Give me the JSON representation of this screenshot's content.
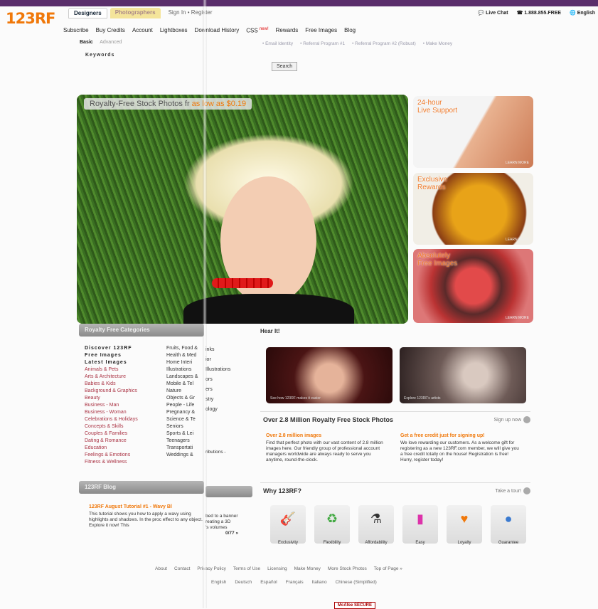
{
  "logo": "123RF",
  "top_tabs": [
    "Designers",
    "Photographers",
    "Sign In • Register"
  ],
  "top_right": [
    "Live Chat",
    "1.888.855.FREE",
    "English"
  ],
  "nav": [
    "Subscribe",
    "Buy Credits",
    "Account",
    "Lightboxes",
    "Download History",
    "CSS",
    "Rewards",
    "Free Images",
    "Blog"
  ],
  "nav_new": "new!",
  "search": {
    "basic": "Basic",
    "advanced": "Advanced",
    "keywords": "Keywords",
    "button": "Search"
  },
  "sub_links": [
    "• Email Identity",
    "• Referral Program #1",
    "• Referral Program #2 (Robust)",
    "• Make Money"
  ],
  "hero": {
    "banner": "Royalty-Free Stock Photos fr",
    "banner_price": "as low as $0.19"
  },
  "side": [
    {
      "caption_1": "24-hour",
      "caption_2": "Live Support",
      "tag": "LEARN MORE"
    },
    {
      "caption_1": "Exclusive",
      "caption_2": "Rewards",
      "tag": "LEARN MORE"
    },
    {
      "caption_1": "Absolutely",
      "caption_2": "Free Images",
      "tag": "LEARN MORE"
    }
  ],
  "categories": {
    "heading": "Royalty Free Categories",
    "col1": [
      "Discover 123RF",
      "Free Images",
      "Latest Images",
      "Animals & Pets",
      "Arts & Architecture",
      "Babies & Kids",
      "Background & Graphics",
      "Beauty",
      "Business - Man",
      "Business - Woman",
      "Celebrations & Holidays",
      "Concepts & Skills",
      "Couples & Families",
      "Dating & Romance",
      "Education",
      "Feelings & Emotions",
      "Fitness & Wellness"
    ],
    "col2": [
      "Fruits, Food &",
      "Health & Med",
      "Home Interi",
      "Illustrations",
      "Landscapes &",
      "Mobile & Tel",
      "Nature",
      "Objects & Gr",
      "People - Life",
      "Pregnancy &",
      "Science & Te",
      "Seniors",
      "Sports & Lei",
      "Teenagers",
      "Transportati",
      "Weddings &"
    ],
    "col3": [
      "inks",
      "",
      "ior",
      "",
      "Illustrations",
      "ors",
      "",
      "ers",
      "",
      "stry",
      "ology"
    ]
  },
  "blog": {
    "heading": "123RF Blog",
    "title": "123RF August Tutorial #1 - Wavy Bl",
    "text": "This tutorial shows you how to apply a wavy using highlights and shadows. In the proc effect to any object. Explore it now! This",
    "side_text": "ributions -",
    "mid_text_1": "bed to a banner",
    "mid_text_2": "reating a 3D",
    "mid_text_3": "'s volumes",
    "more": "0/77 »"
  },
  "hear": {
    "heading": "Hear It!",
    "video_1": "See how 123RF makes it easier",
    "video_2": "Explore 123RF's artists"
  },
  "section_a": {
    "heading": "Over 2.8 Million Royalty Free Stock Photos",
    "link": "Sign up now",
    "left_title": "Over 2.8 million images",
    "left_text": "Find that perfect photo with our vast content of 2.8 million images here. Our friendly group of professional account managers worldwide are always ready to serve you anytime, round-the-clock.",
    "right_title": "Get a free credit just for signing up!",
    "right_text": "We love rewarding our customers. As a welcome gift for registering as a new 123RF.com member, we will give you a free credit totally on the house! Registration is free! Hurry, register today!"
  },
  "section_b": {
    "heading": "Why 123RF?",
    "link": "Take a tour!",
    "icons": [
      {
        "label": "Exclusivity",
        "icon": "guitar-icon",
        "glyph": "🎸"
      },
      {
        "label": "Flexibility",
        "icon": "recycle-icon",
        "glyph": "♻"
      },
      {
        "label": "Affordability",
        "icon": "flask-icon",
        "glyph": "⚗"
      },
      {
        "label": "Easy",
        "icon": "bar-chart-icon",
        "glyph": "▮"
      },
      {
        "label": "Loyalty",
        "icon": "heart-icon",
        "glyph": "♥"
      },
      {
        "label": "Guarantee",
        "icon": "shield-icon",
        "glyph": "●"
      }
    ]
  },
  "footer": {
    "links": [
      "About",
      "Contact",
      "Privacy Policy",
      "Terms of Use",
      "Licensing",
      "Make Money",
      "More Stock Photos",
      "Top of Page »"
    ],
    "languages": [
      "English",
      "Deutsch",
      "Español",
      "Français",
      "Italiano",
      "Chinese (Simplified)"
    ],
    "badge": "McAfee SECURE"
  },
  "colors": {
    "accent": "#f0780a",
    "topbar": "#5a2e6b"
  }
}
